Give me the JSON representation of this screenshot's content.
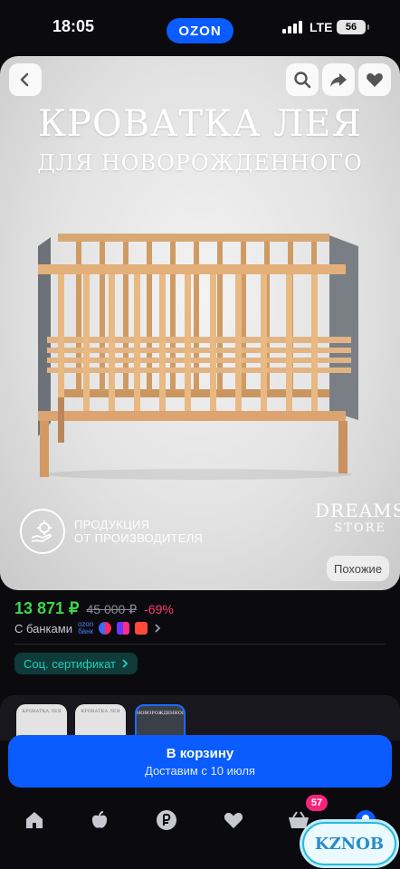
{
  "status_bar": {
    "time": "18:05",
    "app_pill": "OZON",
    "network": "LTE",
    "battery": "56"
  },
  "product_image": {
    "headline_line1": "КРОВАТКА ЛЕЯ",
    "headline_line2": "ДЛЯ НОВОРОЖДЕННОГО",
    "producer_badge_line1": "ПРОДУКЦИЯ",
    "producer_badge_line2": "ОТ ПРОИЗВОДИТЕЛЯ",
    "store_logo_line1": "DREAMS",
    "store_logo_line2": "STORE",
    "similar_button": "Похожие",
    "icons": [
      "back-arrow-icon",
      "search-icon",
      "share-icon",
      "heart-icon"
    ]
  },
  "price": {
    "current": "13 871 ₽",
    "old": "45 000 ₽",
    "discount": "-69%",
    "current_color": "#3ed54a",
    "discount_color": "#ff3b6b"
  },
  "banks": {
    "label": "С банками",
    "ozon_bank_line1": "ozon",
    "ozon_bank_line2": "банк"
  },
  "certificate_chip": {
    "label": "Соц. сертификат",
    "color": "#1fd0b8"
  },
  "variants": [
    {
      "caption": "КРОВАТКА ЛЕЯ"
    },
    {
      "caption": "КРОВАТКА ЛЕЯ"
    },
    {
      "caption": "НОВОРОЖДЕННОГО",
      "selected": true
    }
  ],
  "cart_button": {
    "label": "В корзину",
    "subtitle": "Доставим с 10 июля",
    "color": "#0a5cff"
  },
  "bottom_nav": {
    "items": [
      "home-icon",
      "fresh-apple-icon",
      "ruble-icon",
      "favorites-heart-icon",
      "cart-basket-icon",
      "profile-icon"
    ],
    "cart_badge": "57"
  },
  "watermark": "KZNOB"
}
